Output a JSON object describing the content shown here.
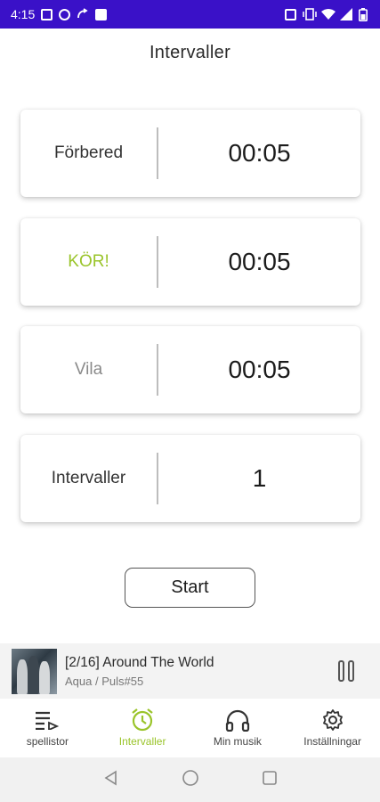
{
  "status_bar": {
    "time": "4:15",
    "left_icons": [
      "calendar-icon",
      "sync-icon",
      "call-forward-icon",
      "image-icon"
    ],
    "right_icons": [
      "nfc-icon",
      "vibrate-icon",
      "wifi-icon",
      "signal-icon",
      "battery-icon"
    ],
    "background": "#3a11c8"
  },
  "page": {
    "title": "Intervaller"
  },
  "intervals": [
    {
      "label": "Förbered",
      "value": "00:05",
      "label_color": "#333333"
    },
    {
      "label": "KÖR!",
      "value": "00:05",
      "label_color": "#9ac42a"
    },
    {
      "label": "Vila",
      "value": "00:05",
      "label_color": "#8a8a8a"
    },
    {
      "label": "Intervaller",
      "value": "1",
      "label_color": "#333333"
    }
  ],
  "start_button": {
    "label": "Start"
  },
  "now_playing": {
    "title": "[2/16] Around The World",
    "subtitle": "Aqua / Puls#55",
    "state_icon": "pause-icon"
  },
  "bottom_nav": {
    "items": [
      {
        "label": "spellistor",
        "icon": "playlist-icon",
        "active": false
      },
      {
        "label": "Intervaller",
        "icon": "alarm-clock-icon",
        "active": true
      },
      {
        "label": "Min musik",
        "icon": "headphones-icon",
        "active": false
      },
      {
        "label": "Inställningar",
        "icon": "gear-icon",
        "active": false
      }
    ],
    "active_color": "#9ac42a"
  },
  "system_nav": {
    "icons": [
      "back-icon",
      "home-icon",
      "recents-icon"
    ]
  }
}
